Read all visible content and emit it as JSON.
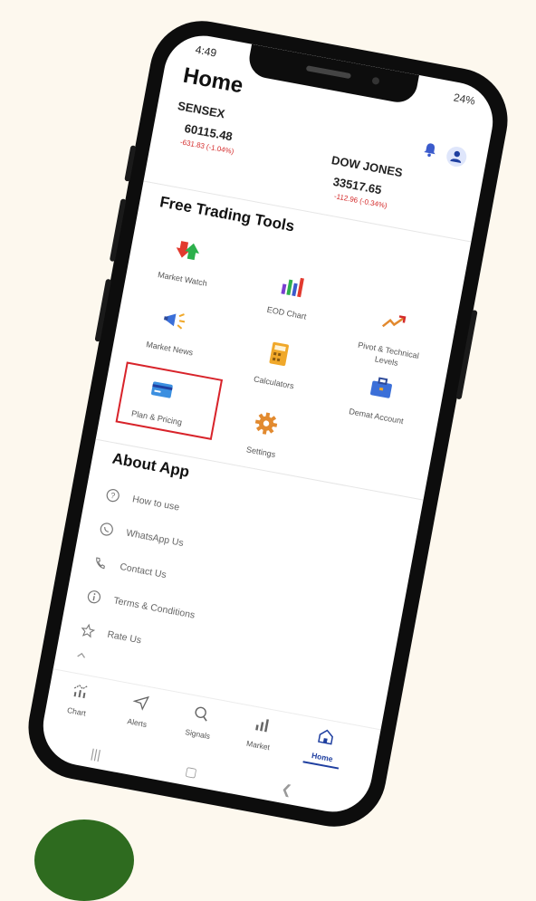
{
  "status_bar": {
    "time": "4:49",
    "signal_battery": "24%"
  },
  "header": {
    "title": "Home"
  },
  "indices": [
    {
      "name": "SENSEX",
      "value": "60115.48",
      "change": "-631.83 (-1.04%)"
    },
    {
      "name": "DOW JONES",
      "value": "33517.65",
      "change": "-112.96 (-0.34%)"
    }
  ],
  "tools": {
    "title": "Free Trading Tools",
    "items": [
      {
        "label": "Market Watch",
        "icon": "market-watch-icon"
      },
      {
        "label": "EOD Chart",
        "icon": "eod-chart-icon"
      },
      {
        "label": "Pivot & Technical Levels",
        "icon": "pivot-icon"
      },
      {
        "label": "Market News",
        "icon": "megaphone-icon"
      },
      {
        "label": "Calculators",
        "icon": "calculator-icon"
      },
      {
        "label": "Demat Account",
        "icon": "briefcase-icon"
      },
      {
        "label": "Plan & Pricing",
        "icon": "credit-card-icon"
      },
      {
        "label": "Settings",
        "icon": "gear-icon"
      }
    ]
  },
  "about": {
    "title": "About App",
    "items": [
      {
        "label": "How to use",
        "icon": "help-icon"
      },
      {
        "label": "WhatsApp Us",
        "icon": "whatsapp-icon"
      },
      {
        "label": "Contact Us",
        "icon": "phone-icon"
      },
      {
        "label": "Terms & Conditions",
        "icon": "info-icon"
      },
      {
        "label": "Rate Us",
        "icon": "star-icon"
      }
    ]
  },
  "bottom_nav": [
    {
      "label": "Chart",
      "icon": "chart-icon"
    },
    {
      "label": "Alerts",
      "icon": "send-icon"
    },
    {
      "label": "Signals",
      "icon": "search-icon"
    },
    {
      "label": "Market",
      "icon": "bar-chart-icon"
    },
    {
      "label": "Home",
      "icon": "home-icon",
      "active": true
    }
  ],
  "colors": {
    "accent": "#1f3fa0",
    "negative": "#d42b2b",
    "highlight": "#d8232a",
    "background": "#fdf8ee"
  }
}
